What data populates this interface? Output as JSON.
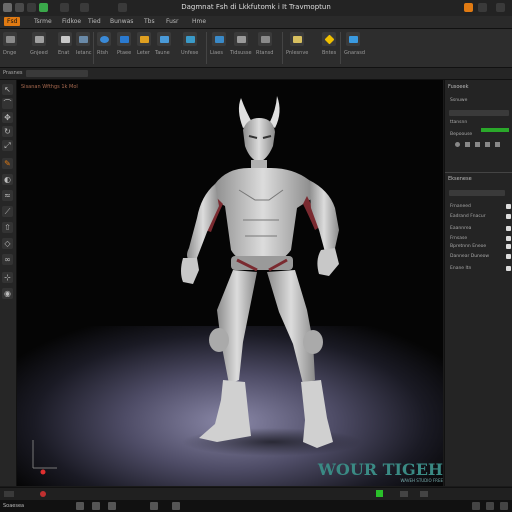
{
  "window": {
    "title": "Dagmnat Fsh di Lkkfutomk i It Travmoptun"
  },
  "menubar": {
    "items": [
      {
        "label": "Fsd",
        "active": true
      },
      {
        "label": "Tsrme"
      },
      {
        "label": "Fidkoe"
      },
      {
        "label": "Tied"
      },
      {
        "label": "Bunwas"
      },
      {
        "label": "Tbs"
      },
      {
        "label": "Fusr"
      },
      {
        "label": "Hme"
      }
    ]
  },
  "ribbon": {
    "groups": [
      {
        "label": "Dnge",
        "icon": "cube-icon"
      },
      {
        "label": "Gnjeed",
        "icon": "layers-icon"
      },
      {
        "label": "Enat",
        "icon": "brush-icon"
      },
      {
        "label": "Ietanc",
        "icon": "move-icon"
      },
      {
        "label": "Rtsh",
        "icon": "sphere-icon"
      },
      {
        "label": "Ptaee",
        "icon": "mesh-icon"
      },
      {
        "label": "Leter",
        "icon": "bolt-icon"
      },
      {
        "label": "Taune",
        "icon": "lattice-icon"
      },
      {
        "label": "Unfese",
        "icon": "shield-icon"
      },
      {
        "label": "Liaes",
        "icon": "camera-icon"
      },
      {
        "label": "Tidsusse",
        "icon": "grid-icon"
      },
      {
        "label": "Rtansd",
        "icon": "cloth-icon"
      },
      {
        "label": "Pnlesnve",
        "icon": "document-icon"
      },
      {
        "label": "Bntes",
        "icon": "diamond-icon"
      },
      {
        "label": "Gnarasd",
        "icon": "render-icon"
      }
    ]
  },
  "subbar": {
    "label": "Prasnes"
  },
  "viewport": {
    "label": "Sisanan Wfthgs 1k Mol",
    "watermark": "WOUR TIGEH",
    "watermark_sub": "WAVEH STUDIO FREE",
    "colors": {
      "floor": "#8a88a8",
      "accent": "#7a2a30",
      "body": "#d8d8d8"
    }
  },
  "rightpanel": {
    "title": "Fusoeek",
    "items": [
      "Ssnuwe",
      "ttansnn",
      "Bepoouse"
    ],
    "properties_title": "Eksenese",
    "props": [
      "Frnaneed",
      "Eadrand Fnacur",
      "Eaannrea",
      "Frnsase",
      "Bpretnnn Eneoe",
      "Dannear Duneow",
      "Enane ltn"
    ]
  },
  "status": {
    "label": "Soaesea"
  }
}
